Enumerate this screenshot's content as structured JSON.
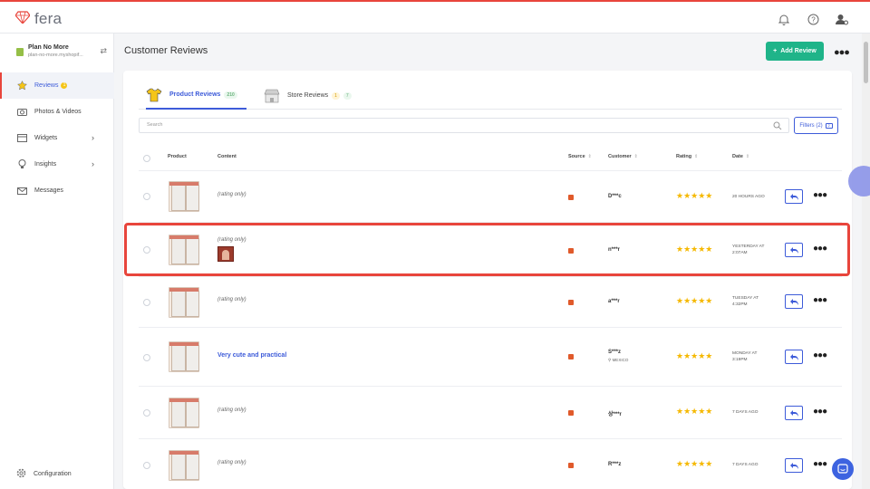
{
  "app": {
    "logo_text": "fera"
  },
  "store": {
    "name": "Plan No More",
    "url": "plan-no-more.myshopif..."
  },
  "sidebar": {
    "items": [
      {
        "label": "Reviews",
        "badge": "1"
      },
      {
        "label": "Photos & Videos"
      },
      {
        "label": "Widgets"
      },
      {
        "label": "Insights"
      },
      {
        "label": "Messages"
      }
    ],
    "config_label": "Configuration"
  },
  "page": {
    "title": "Customer Reviews",
    "add_button": "Add Review"
  },
  "tabs": [
    {
      "label": "Product Reviews",
      "count": "210"
    },
    {
      "label": "Store Reviews",
      "count_a": "1",
      "count_b": "7"
    }
  ],
  "search": {
    "placeholder": "Search"
  },
  "filters": {
    "label": "Filters (2)",
    "count": "2"
  },
  "table": {
    "headers": {
      "product": "Product",
      "content": "Content",
      "source": "Source",
      "customer": "Customer",
      "rating": "Rating",
      "date": "Date"
    },
    "rows": [
      {
        "content": "(rating only)",
        "customer": "D***c",
        "rating": 5,
        "date_line1": "20 HOURS AGO",
        "date_line2": ""
      },
      {
        "content": "(rating only)",
        "customer": "n***r",
        "rating": 5,
        "date_line1": "YESTERDAY AT",
        "date_line2": "2:07AM"
      },
      {
        "content": "(rating only)",
        "customer": "a***r",
        "rating": 5,
        "date_line1": "TUESDAY AT",
        "date_line2": "4:32PM"
      },
      {
        "content": "Very cute and practical",
        "customer": "S***z",
        "location": "MEXICO",
        "rating": 5,
        "date_line1": "MONDAY AT",
        "date_line2": "3:19PM"
      },
      {
        "content": "(rating only)",
        "customer": "상***r",
        "rating": 5,
        "date_line1": "7 DAYS AGO",
        "date_line2": ""
      },
      {
        "content": "(rating only)",
        "customer": "R***z",
        "rating": 5,
        "date_line1": "7 DAYS AGO",
        "date_line2": ""
      }
    ]
  },
  "colors": {
    "accent": "#3d5bd9",
    "green": "#1fb489",
    "highlight": "#e8453c",
    "star": "#f5b800"
  }
}
